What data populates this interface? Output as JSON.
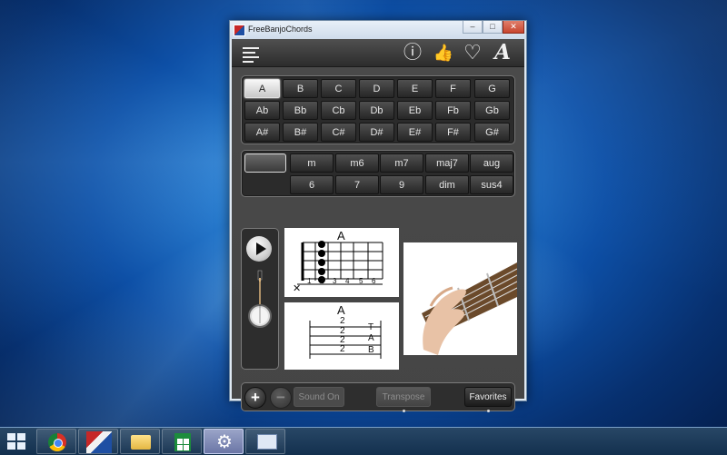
{
  "window": {
    "title": "FreeBanjoChords",
    "min": "–",
    "max": "□",
    "close": "✕"
  },
  "toolbar": {
    "menu_icon": "menu-icon",
    "info_icon": "info-icon",
    "info_glyph": "ⓘ",
    "like_glyph": "👍",
    "favorite_glyph": "♡",
    "font_glyph": "A"
  },
  "keys": {
    "rows": [
      [
        "A",
        "B",
        "C",
        "D",
        "E",
        "F",
        "G"
      ],
      [
        "Ab",
        "Bb",
        "Cb",
        "Db",
        "Eb",
        "Fb",
        "Gb"
      ],
      [
        "A#",
        "B#",
        "C#",
        "D#",
        "E#",
        "F#",
        "G#"
      ]
    ],
    "selected": "A"
  },
  "chord_types": {
    "rows": [
      [
        "m",
        "m6",
        "m7",
        "maj7",
        "aug"
      ],
      [
        "6",
        "7",
        "9",
        "dim",
        "sus4"
      ]
    ],
    "selected": ""
  },
  "chord_diagram": {
    "name": "A",
    "muted": "✕",
    "fret_numbers": [
      "1",
      "2",
      "3",
      "4",
      "5",
      "6"
    ]
  },
  "tab": {
    "name": "A",
    "values": [
      "2",
      "2",
      "2",
      "2"
    ],
    "labels": [
      "T",
      "A",
      "B"
    ]
  },
  "bottom": {
    "plus": "+",
    "minus": "−",
    "sound": "Sound On",
    "transpose": "Transpose",
    "favorites": "Favorites"
  },
  "taskbar": {
    "items": [
      "chrome-icon",
      "banjo-app-icon",
      "folder-icon",
      "store-icon",
      "gear-icon",
      "remote-desktop-icon"
    ],
    "gear_glyph": "⚙"
  }
}
